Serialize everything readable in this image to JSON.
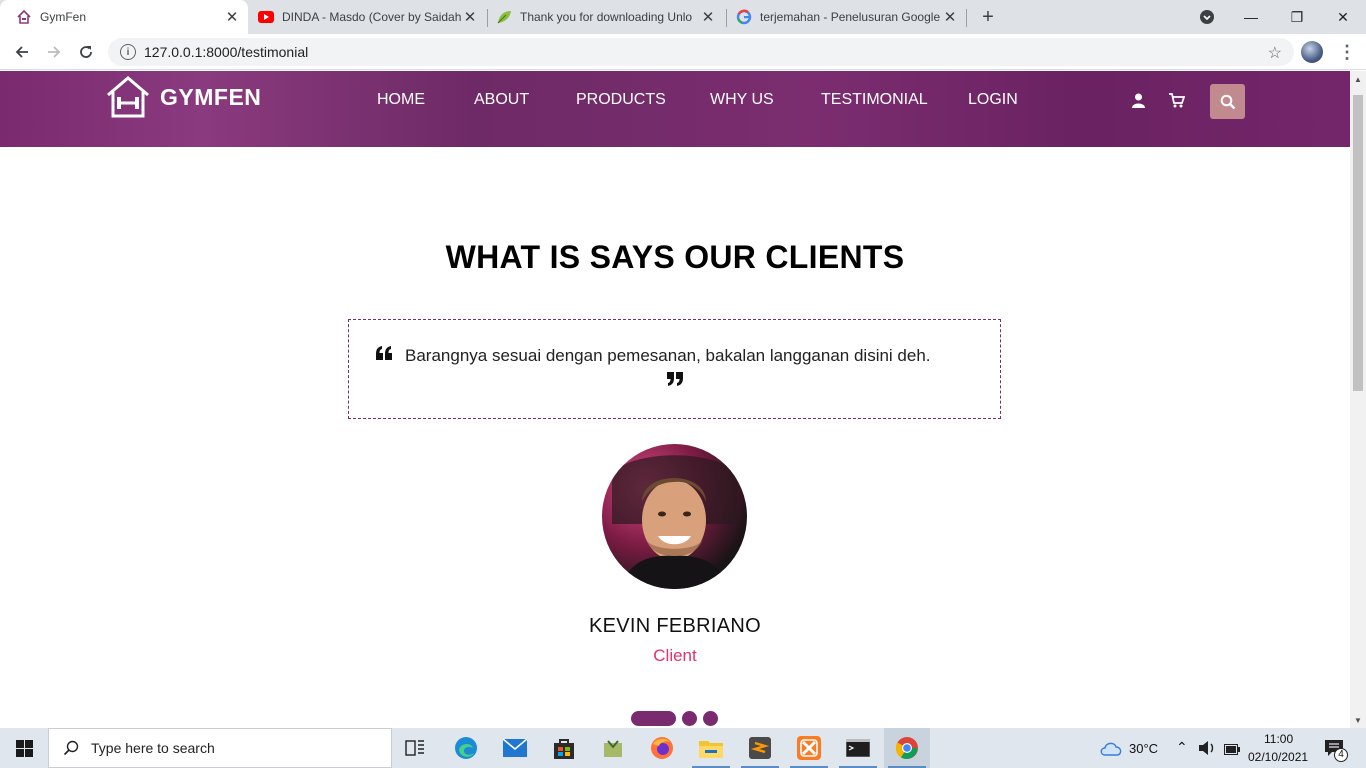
{
  "browser": {
    "tabs": [
      {
        "title": "GymFen",
        "icon": "house-icon",
        "active": true
      },
      {
        "title": "DINDA - Masdo (Cover by Saidah",
        "icon": "youtube-icon",
        "active": false
      },
      {
        "title": "Thank you for downloading Unlo",
        "icon": "leaf-icon",
        "active": false
      },
      {
        "title": "terjemahan - Penelusuran Google",
        "icon": "google-icon",
        "active": false
      }
    ],
    "url": "127.0.0.1:8000/testimonial"
  },
  "site": {
    "brand": "GYMFEN",
    "nav": [
      "HOME",
      "ABOUT",
      "PRODUCTS",
      "WHY US",
      "TESTIMONIAL",
      "LOGIN"
    ],
    "header_bg": "#7a2a6e",
    "search_button_color": "#c08a8e"
  },
  "testimonial": {
    "heading": "WHAT IS SAYS OUR CLIENTS",
    "quote": "Barangnya sesuai dengan pemesanan, bakalan langganan disini deh.",
    "client_name": "KEVIN FEBRIANO",
    "client_role": "Client",
    "accent_color": "#e0336f",
    "carousel_count": 3,
    "carousel_active_index": 0
  },
  "taskbar": {
    "search_placeholder": "Type here to search",
    "weather": "30°C",
    "time": "11:00",
    "date": "02/10/2021",
    "notifications": "4"
  }
}
